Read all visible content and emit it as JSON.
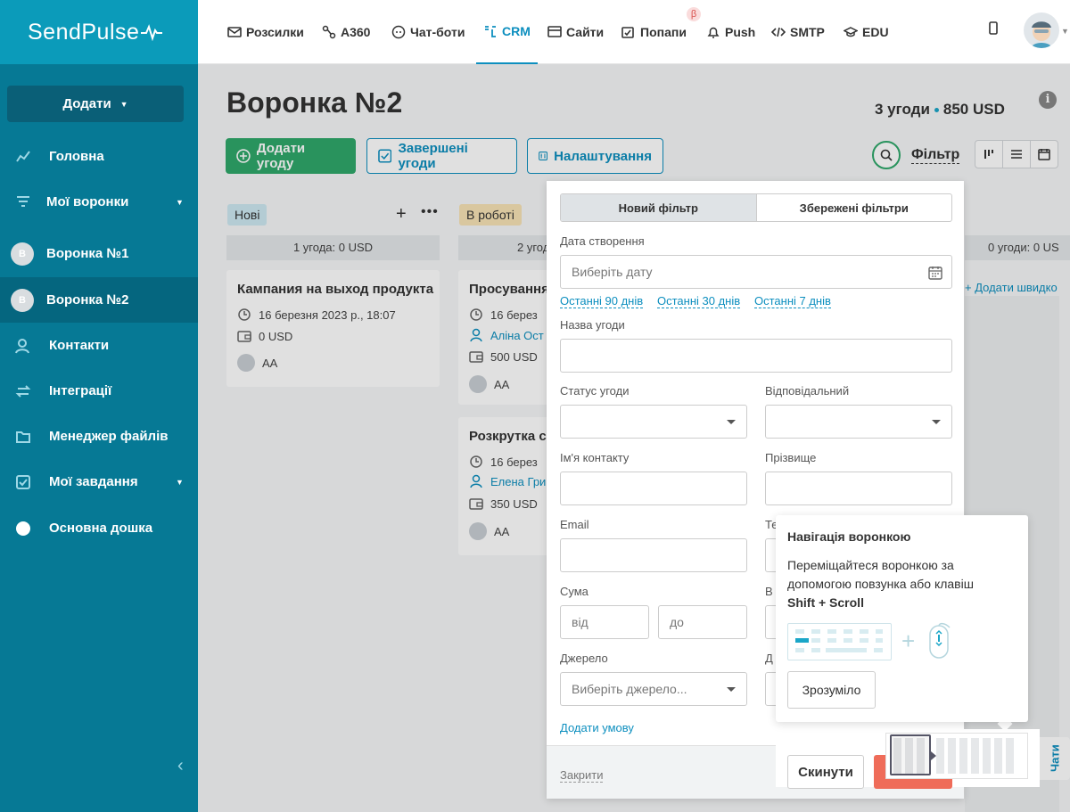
{
  "brand": {
    "logo_text": "SendPulse"
  },
  "topnav": {
    "items": [
      {
        "label": "Розсилки",
        "icon": "mail-icon"
      },
      {
        "label": "A360",
        "icon": "automation-icon"
      },
      {
        "label": "Чат-боти",
        "icon": "chatbot-icon"
      },
      {
        "label": "CRM",
        "icon": "crm-icon",
        "active": true
      },
      {
        "label": "Сайти",
        "icon": "website-icon"
      },
      {
        "label": "Попапи",
        "icon": "popup-icon"
      },
      {
        "label": "Push",
        "icon": "bell-icon"
      },
      {
        "label": "SMTP",
        "icon": "code-icon"
      },
      {
        "label": "EDU",
        "icon": "graduation-cap-icon"
      }
    ],
    "beta_badge": "β"
  },
  "sidebar": {
    "add_button": "Додати",
    "items": [
      {
        "label": "Головна",
        "icon": "dashboard-icon"
      },
      {
        "label": "Мої воронки",
        "icon": "funnel-icon"
      },
      {
        "label": "Воронка №1",
        "avatar": "B"
      },
      {
        "label": "Воронка №2",
        "avatar": "B"
      },
      {
        "label": "Контакти",
        "icon": "contacts-icon"
      },
      {
        "label": "Інтеграції",
        "icon": "integrations-icon"
      },
      {
        "label": "Менеджер файлів",
        "icon": "folder-icon"
      },
      {
        "label": "Мої завдання",
        "icon": "tasks-icon"
      },
      {
        "label": "Основна дошка",
        "icon": "circle-icon"
      }
    ]
  },
  "main": {
    "title": "Воронка №2",
    "summary_deals": "3 угоди",
    "summary_amount": "850 USD",
    "buttons": {
      "add_deal": "Додати угоду",
      "completed": "Завершені угоди",
      "settings": "Налаштування"
    },
    "filter_label": "Фільтр"
  },
  "columns": [
    {
      "tag": "Нові",
      "tag_color": "#cde9f2",
      "summary": "1 угода: 0 USD",
      "cards": [
        {
          "title": "Кампания на выход продукта",
          "date": "16 березня 2023 р., 18:07",
          "amount": "0 USD",
          "owner": "AA"
        }
      ]
    },
    {
      "tag": "В роботі",
      "tag_color": "#f7e3b5",
      "summary": "2 угод",
      "cards": [
        {
          "title": "Просування",
          "date": "16 берез",
          "contact": "Аліна Ост",
          "amount": "500 USD",
          "owner": "AA"
        },
        {
          "title": "Розкрутка с",
          "date": "16 берез",
          "contact": "Елена Гри",
          "amount": "350 USD",
          "owner": "AA"
        }
      ]
    },
    {
      "summary": "0 угоди: 0 US",
      "add_quick": "+ Додати швидко"
    }
  ],
  "filter_panel": {
    "tab_new": "Новий фільтр",
    "tab_saved": "Збережені фільтри",
    "created_label": "Дата створення",
    "date_placeholder": "Виберіть дату",
    "quick_ranges": [
      "Останні 90 днів",
      "Останні 30 днів",
      "Останні 7 днів"
    ],
    "deal_name_label": "Назва угоди",
    "status_label": "Статус угоди",
    "responsible_label": "Відповідальний",
    "contact_name_label": "Ім'я контакту",
    "surname_label": "Прізвище",
    "email_label": "Email",
    "phone_label_partial": "Те",
    "sum_label": "Сума",
    "sum_from": "від",
    "sum_to": "до",
    "right_label_b": "В",
    "source_label": "Джерело",
    "source_placeholder": "Виберіть джерело...",
    "right_label_d": "Д",
    "add_condition": "Додати умову",
    "close": "Закрити",
    "reset": "Скинути"
  },
  "tooltip": {
    "title": "Навігація воронкою",
    "text": "Переміщайтеся воронкою за допомогою повзунка або клавіш",
    "keys": "Shift + Scroll",
    "ok_button": "Зрозуміло"
  },
  "chats_tab": "Чати",
  "colors": {
    "sidebar": "#067995",
    "accent": "#0d8fbf",
    "green": "#2fa86a",
    "apply": "#ef6c59"
  }
}
